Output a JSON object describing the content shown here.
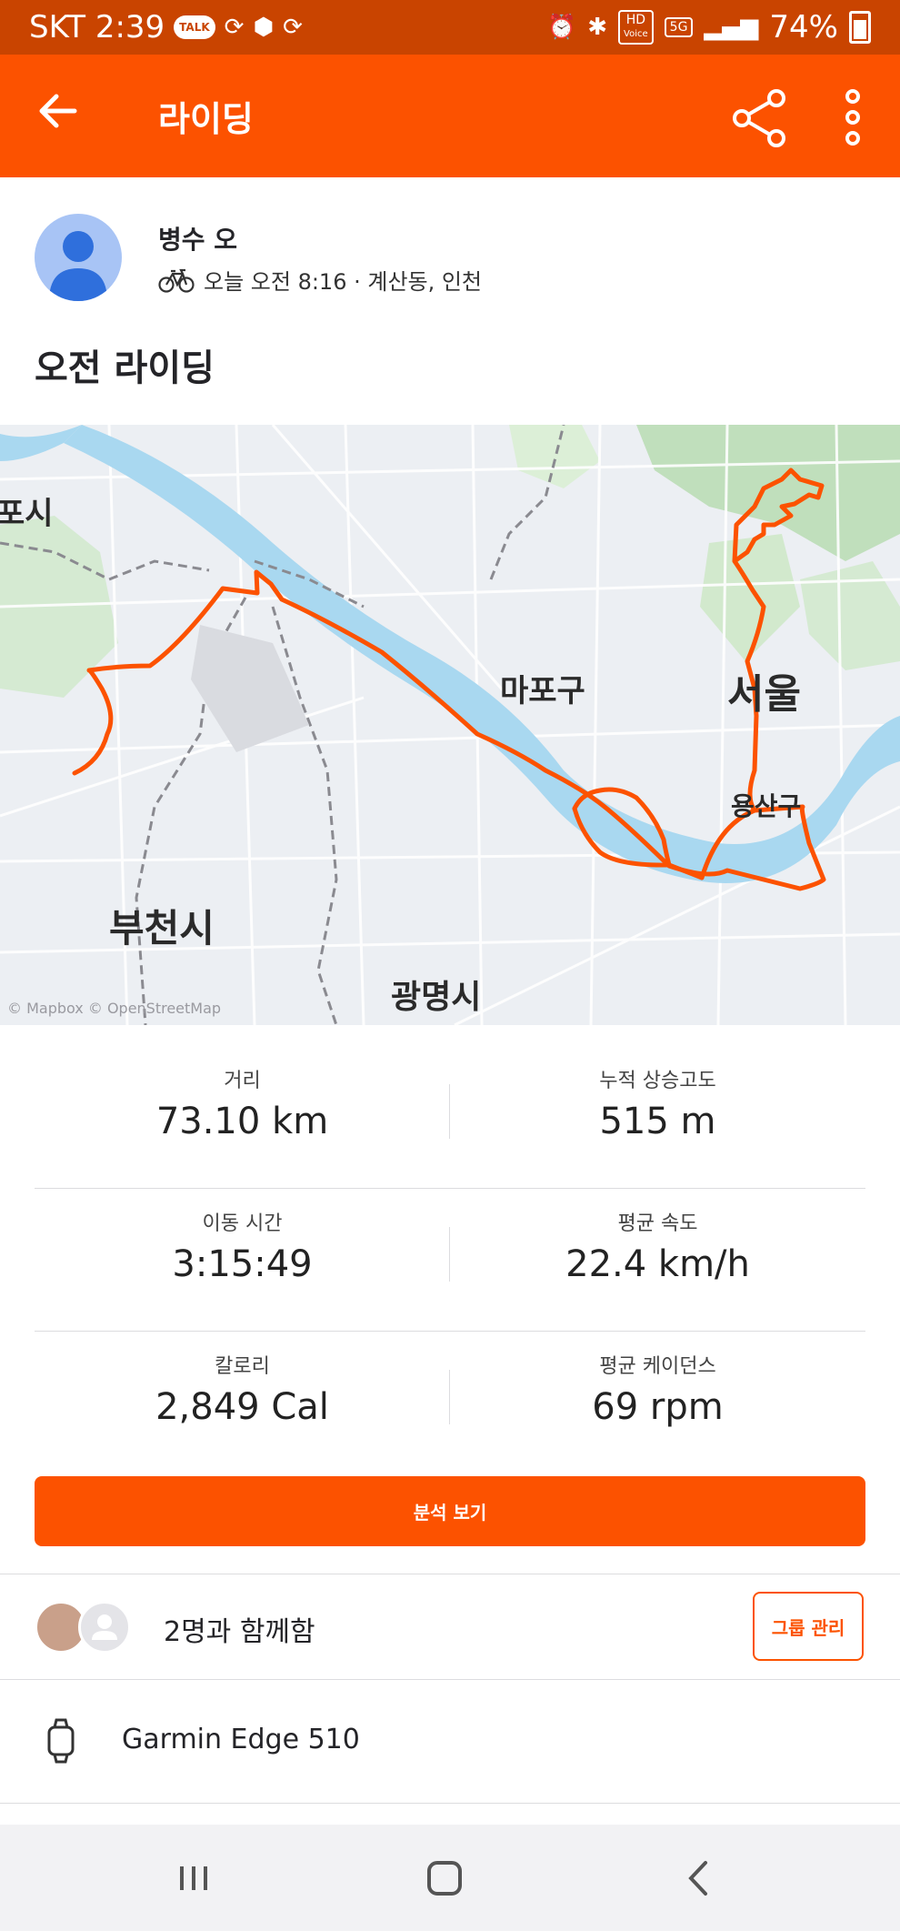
{
  "status": {
    "carrier_time": "SKT 2:39",
    "talk": "TALK",
    "hd": "HD",
    "voice": "Voice",
    "net": "5G",
    "battery": "74%"
  },
  "appbar": {
    "title": "라이딩"
  },
  "athlete": {
    "name": "병수 오",
    "meta": "오늘 오전 8:16 · 계산동, 인천"
  },
  "activity": {
    "title": "오전 라이딩"
  },
  "map": {
    "labels": {
      "gimpo": "포시",
      "mapo": "마포구",
      "seoul": "서울",
      "yongsan": "용산구",
      "bucheon": "부천시",
      "gwangmyeong": "광명시"
    },
    "attribution": "© Mapbox  © OpenStreetMap"
  },
  "stats": {
    "distance": {
      "label": "거리",
      "value": "73.10 km"
    },
    "elevation": {
      "label": "누적 상승고도",
      "value": "515 m"
    },
    "moving_time": {
      "label": "이동 시간",
      "value": "3:15:49"
    },
    "avg_speed": {
      "label": "평균 속도",
      "value": "22.4 km/h"
    },
    "calories": {
      "label": "칼로리",
      "value": "2,849 Cal"
    },
    "avg_cadence": {
      "label": "평균 케이던스",
      "value": "69 rpm"
    }
  },
  "analyze_label": "분석 보기",
  "group": {
    "text": "2명과 함께함",
    "button": "그룹 관리"
  },
  "device": {
    "name": "Garmin Edge 510"
  },
  "colors": {
    "brand": "#fc5200",
    "status_bar": "#c94400",
    "route": "#fc5200",
    "river": "#a9d8f0"
  }
}
